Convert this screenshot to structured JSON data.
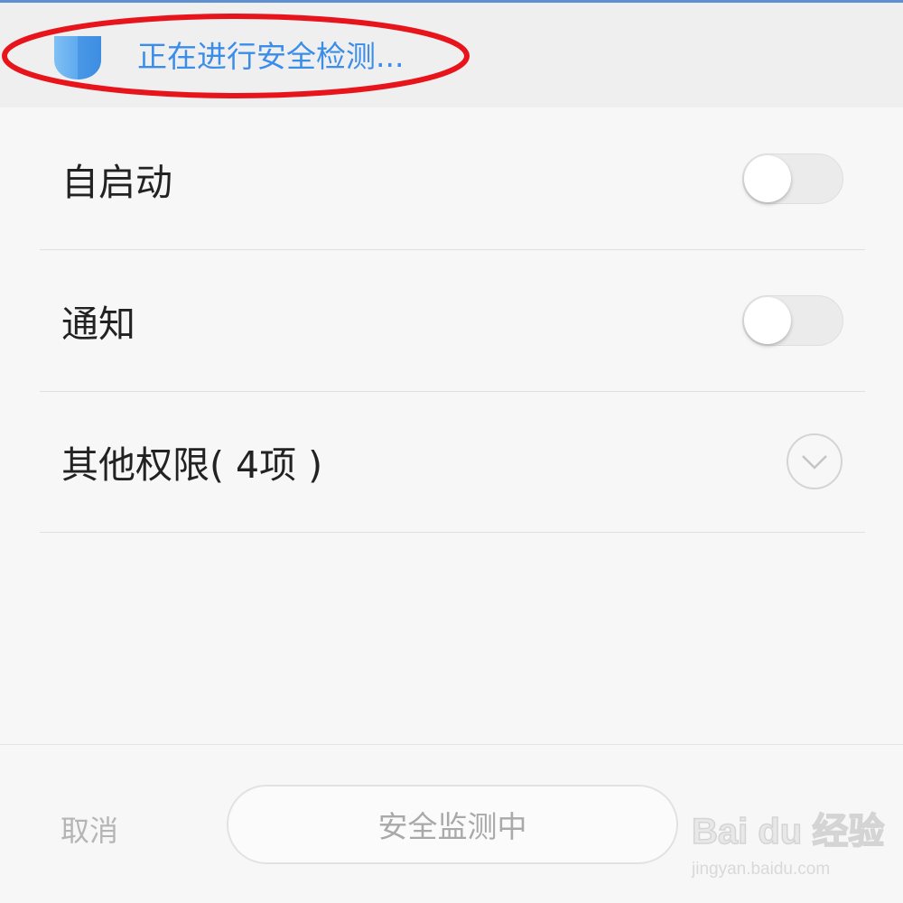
{
  "header": {
    "status_text": "正在进行安全检测...",
    "shield_icon": "shield-icon",
    "accent_color": "#3a8de8",
    "highlight_color": "#e8141c"
  },
  "permissions": [
    {
      "label": "自启动",
      "control": "toggle",
      "enabled": false
    },
    {
      "label": "通知",
      "control": "toggle",
      "enabled": false
    },
    {
      "label": "其他权限( 4项 )",
      "control": "expand",
      "icon": "chevron-down-icon"
    }
  ],
  "footer": {
    "cancel_label": "取消",
    "main_button_label": "安全监测中"
  },
  "watermark": {
    "brand": "Bai du 经验",
    "url": "jingyan.baidu.com"
  }
}
